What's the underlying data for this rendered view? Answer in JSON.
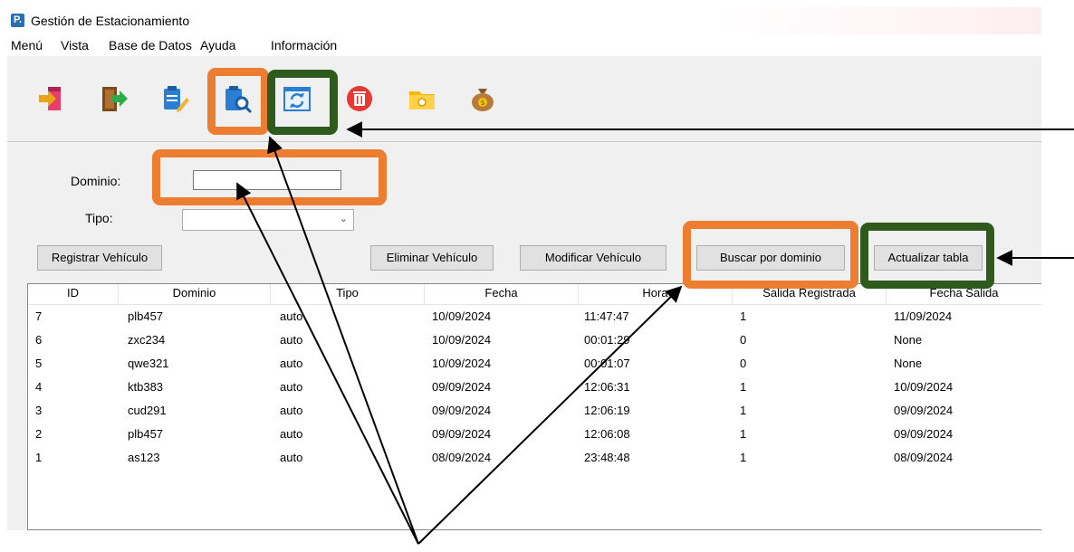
{
  "window": {
    "title": "Gestión de Estacionamiento",
    "app_icon": "P."
  },
  "menu": [
    "Menú",
    "Vista",
    "Base de Datos",
    "Ayuda",
    "Información"
  ],
  "toolbar": [
    "enter-icon",
    "exit-icon",
    "edit-document-icon",
    "search-document-icon",
    "refresh-icon",
    "delete-icon",
    "folder-icon",
    "money-bag-icon"
  ],
  "form": {
    "dominio_label": "Dominio:",
    "dominio_value": "",
    "tipo_label": "Tipo:",
    "tipo_value": ""
  },
  "buttons": {
    "registrar": "Registrar Vehículo",
    "eliminar": "Eliminar Vehículo",
    "modificar": "Modificar Vehículo",
    "buscar": "Buscar por dominio",
    "actualizar": "Actualizar tabla"
  },
  "table": {
    "columns": [
      "ID",
      "Dominio",
      "Tipo",
      "Fecha",
      "Hora",
      "Salida Registrada",
      "Fecha Salida"
    ],
    "rows": [
      [
        "7",
        "plb457",
        "auto",
        "10/09/2024",
        "11:47:47",
        "1",
        "11/09/2024"
      ],
      [
        "6",
        "zxc234",
        "auto",
        "10/09/2024",
        "00:01:29",
        "0",
        "None"
      ],
      [
        "5",
        "qwe321",
        "auto",
        "10/09/2024",
        "00:01:07",
        "0",
        "None"
      ],
      [
        "4",
        "ktb383",
        "auto",
        "09/09/2024",
        "12:06:31",
        "1",
        "10/09/2024"
      ],
      [
        "3",
        "cud291",
        "auto",
        "09/09/2024",
        "12:06:19",
        "1",
        "09/09/2024"
      ],
      [
        "2",
        "plb457",
        "auto",
        "09/09/2024",
        "12:06:08",
        "1",
        "09/09/2024"
      ],
      [
        "1",
        "as123",
        "auto",
        "08/09/2024",
        "23:48:48",
        "1",
        "08/09/2024"
      ]
    ]
  },
  "colors": {
    "highlight_orange": "#ed7d31",
    "highlight_green": "#2e5a1e"
  }
}
